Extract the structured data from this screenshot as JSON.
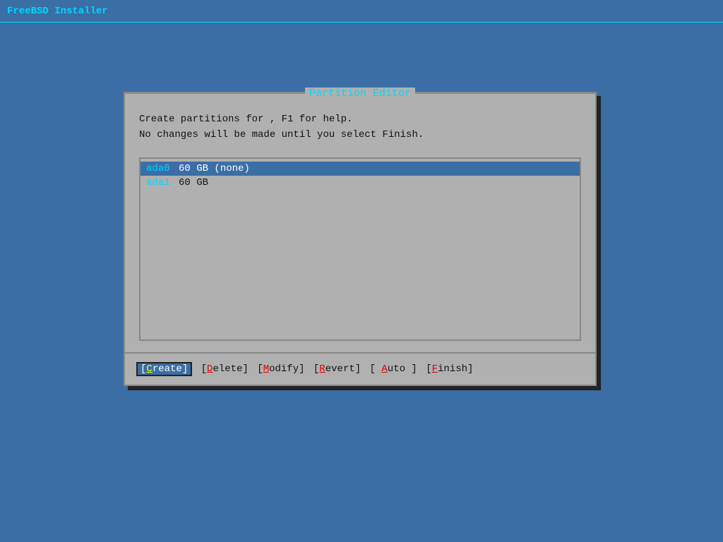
{
  "app": {
    "title": "FreeBSD Installer"
  },
  "dialog": {
    "title": "Partition Editor",
    "description_line1": "Create partitions for , F1 for help.",
    "description_line2": "No changes will be made until you select Finish."
  },
  "partitions": [
    {
      "name": "ada0",
      "info": "60 GB (none)",
      "selected": true
    },
    {
      "name": "ada1",
      "info": "60 GB",
      "selected": false
    }
  ],
  "buttons": [
    {
      "label": "Create",
      "selected": true,
      "prefix": "[",
      "suffix": "]",
      "underline_char": "C"
    },
    {
      "label": "Delete",
      "selected": false,
      "prefix": "[D",
      "suffix": "]",
      "underline_char": "D"
    },
    {
      "label": "Modify",
      "selected": false,
      "prefix": "[M",
      "suffix": "]",
      "underline_char": "M"
    },
    {
      "label": "Revert",
      "selected": false,
      "prefix": "[R",
      "suffix": "]",
      "underline_char": "R"
    },
    {
      "label": " Auto ",
      "selected": false,
      "prefix": "[ ",
      "suffix": " ]",
      "underline_char": "A"
    },
    {
      "label": "Finish",
      "selected": false,
      "prefix": "[F",
      "suffix": "]",
      "underline_char": "F"
    }
  ]
}
